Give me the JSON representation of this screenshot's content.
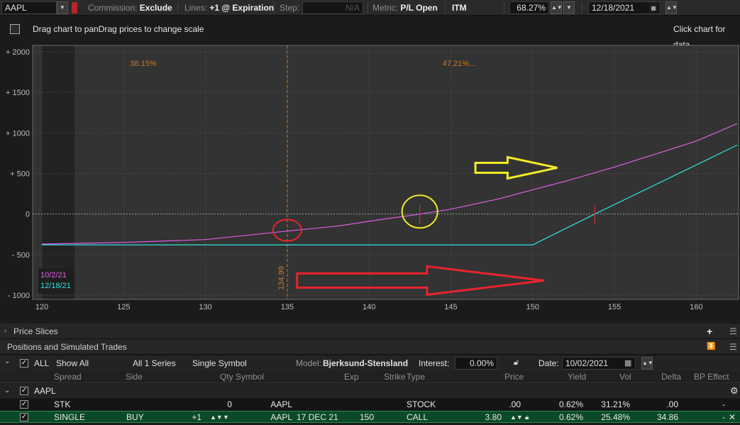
{
  "toolbar": {
    "symbol": "AAPL",
    "commission_label": "Commission:",
    "commission_value": "Exclude",
    "lines_label": "Lines:",
    "lines_value": "+1 @ Expiration",
    "step_label": "Step:",
    "step_value": "N/A",
    "metric_label": "Metric:",
    "metric_value": "P/L Open",
    "itm_label": "ITM",
    "percent_value": "68.27%",
    "date_value": "12/18/2021"
  },
  "info": {
    "left_text": "Drag chart to panDrag prices to change scale",
    "right_text": "Click chart for data"
  },
  "chart_data": {
    "type": "line",
    "x_range": [
      119.5,
      162.5
    ],
    "y_range": [
      -1050,
      2050
    ],
    "x_ticks": [
      120,
      125,
      130,
      135,
      140,
      145,
      150,
      155,
      160
    ],
    "x_tick_labels": [
      "120",
      "125",
      "130",
      "135",
      "140",
      "145",
      "150",
      "155",
      "160"
    ],
    "y_ticks": [
      2000,
      1500,
      1000,
      500,
      0,
      -500,
      -1000
    ],
    "y_tick_labels": [
      "+ 2000",
      "+ 1500",
      "+ 1000",
      "+ 500",
      "0",
      "- 500",
      "- 1000"
    ],
    "top_annotations": [
      {
        "x": 126.2,
        "text": "38.15%"
      },
      {
        "x": 145.5,
        "text": "47.21%..."
      }
    ],
    "current_price": {
      "x": 135,
      "label": "134.99"
    },
    "shaded_until_x": 122,
    "series": [
      {
        "name": "10/2/21",
        "color": "#e05ee8",
        "points": [
          [
            120,
            -370
          ],
          [
            125,
            -350
          ],
          [
            130,
            -315
          ],
          [
            135,
            -210
          ],
          [
            138,
            -150
          ],
          [
            141,
            -60
          ],
          [
            143,
            -5
          ],
          [
            145,
            60
          ],
          [
            148,
            190
          ],
          [
            150,
            300
          ],
          [
            152,
            405
          ],
          [
            155,
            580
          ],
          [
            158,
            770
          ],
          [
            160,
            900
          ],
          [
            162.5,
            1115
          ]
        ]
      },
      {
        "name": "12/18/21",
        "color": "#2fe0e0",
        "points": [
          [
            120,
            -380
          ],
          [
            145,
            -380
          ],
          [
            150,
            -380
          ],
          [
            153.8,
            0
          ],
          [
            162.5,
            850
          ]
        ]
      }
    ],
    "markers": [
      {
        "x": 143.1,
        "y": 0,
        "color": "#ff2a2a"
      },
      {
        "x": 153.8,
        "y": 0,
        "color": "#ff2a2a"
      }
    ],
    "annotation_shapes": [
      {
        "kind": "circle",
        "x": 135,
        "y": -200,
        "color": "#e8242e"
      },
      {
        "kind": "circle",
        "x": 143.1,
        "y": 30,
        "color": "#f2ea28"
      },
      {
        "kind": "arrow",
        "x1": 146.5,
        "x2": 151.5,
        "y": 570,
        "color": "#f2ea28"
      },
      {
        "kind": "arrow",
        "x1": 135.6,
        "x2": 150.7,
        "y": -820,
        "color": "#e8242e"
      }
    ]
  },
  "panels": {
    "price_slices": "Price Slices",
    "positions": "Positions and Simulated Trades"
  },
  "filter": {
    "all": "ALL",
    "show_all": "Show All",
    "series": "All 1 Series",
    "symbol_mode": "Single Symbol",
    "model_label": "Model:",
    "model_value": "Bjerksund-Stensland",
    "interest_label": "Interest:",
    "interest_value": "0.00%",
    "date_label": "Date:",
    "date_value": "10/02/2021"
  },
  "columns": {
    "spread": "Spread",
    "side": "Side",
    "qty": "Qty",
    "symbol": "Symbol",
    "exp": "Exp",
    "strike": "Strike",
    "type": "Type",
    "price": "Price",
    "yield": "Yield",
    "vol": "Vol",
    "delta": "Delta",
    "bp_effect": "BP Effect"
  },
  "group": {
    "label": "AAPL"
  },
  "rows": [
    {
      "spread": "STK",
      "side": "",
      "qty": "0",
      "symbol": "AAPL",
      "exp": "",
      "strike": "",
      "type": "STOCK",
      "price": ".00",
      "yield": "0.62%",
      "vol": "31.21%",
      "delta": ".00",
      "bp": "-"
    },
    {
      "spread": "SINGLE",
      "side": "BUY",
      "qty": "+1",
      "symbol": "AAPL",
      "exp": "17 DEC 21",
      "strike": "150",
      "type": "CALL",
      "price": "3.80",
      "yield": "0.62%",
      "vol": "25.48%",
      "delta": "34.86",
      "bp": "-"
    }
  ]
}
